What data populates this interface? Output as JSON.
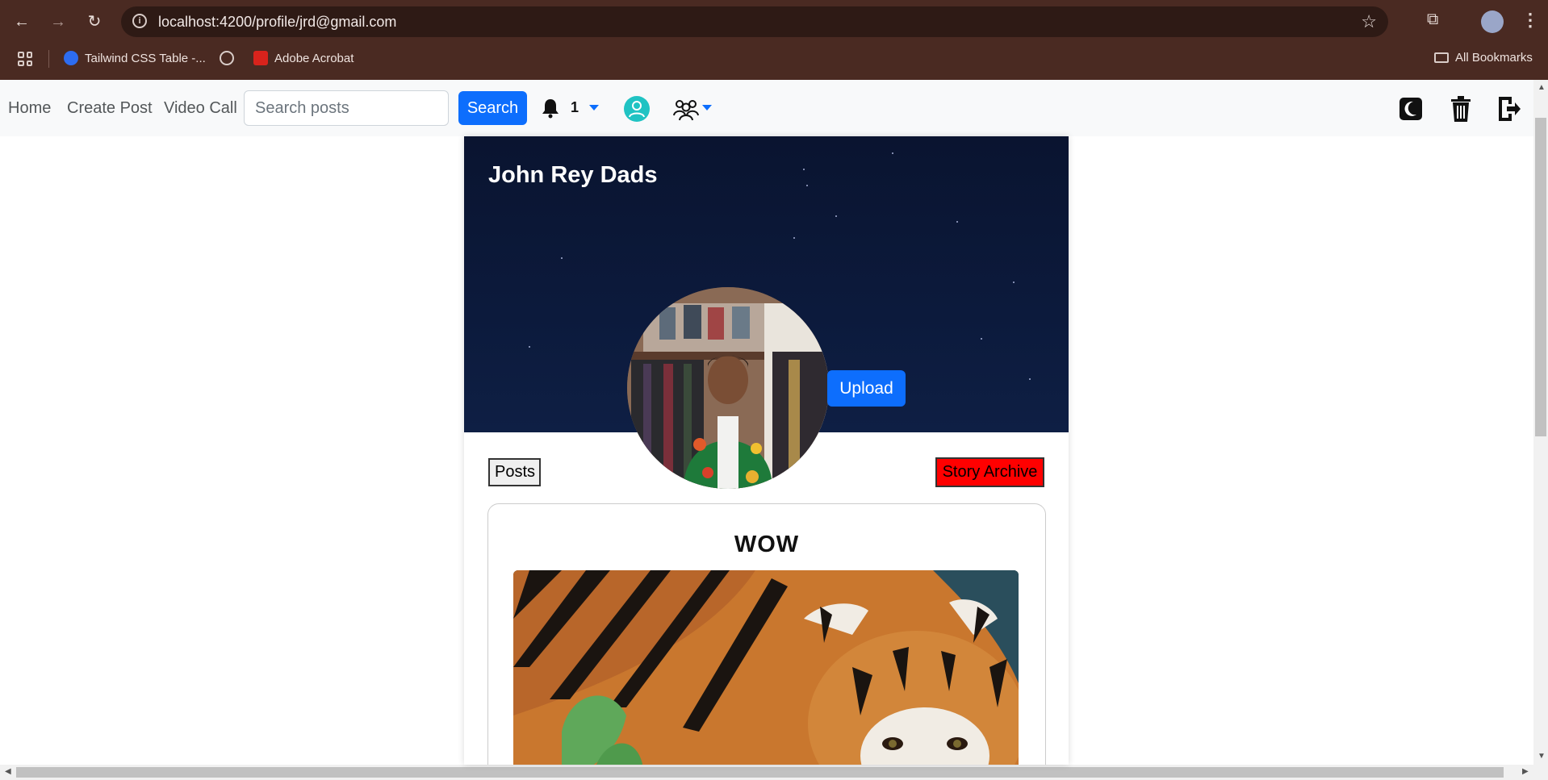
{
  "browser": {
    "url": "localhost:4200/profile/jrd@gmail.com",
    "bookmarks": [
      {
        "label": "Tailwind CSS Table -...",
        "icon": "tailwind-icon"
      },
      {
        "label": "",
        "icon": "globe-icon"
      },
      {
        "label": "Adobe Acrobat",
        "icon": "acrobat-icon"
      }
    ],
    "all_bookmarks": "All Bookmarks"
  },
  "navbar": {
    "home": "Home",
    "create_post": "Create Post",
    "video_call": "Video Call",
    "search_placeholder": "Search posts",
    "search_button": "Search",
    "notification_count": "1",
    "colors": {
      "primary": "#0d6efd",
      "user": "#20c3c3"
    }
  },
  "profile": {
    "name": "John Rey Dads",
    "upload_button": "Upload",
    "posts_button": "Posts",
    "story_archive_button": "Story Archive",
    "colors": {
      "story_archive": "#ff0000",
      "cover": "#0c1a3c"
    }
  },
  "post": {
    "title": "WOW",
    "image": "tiger-photo"
  }
}
